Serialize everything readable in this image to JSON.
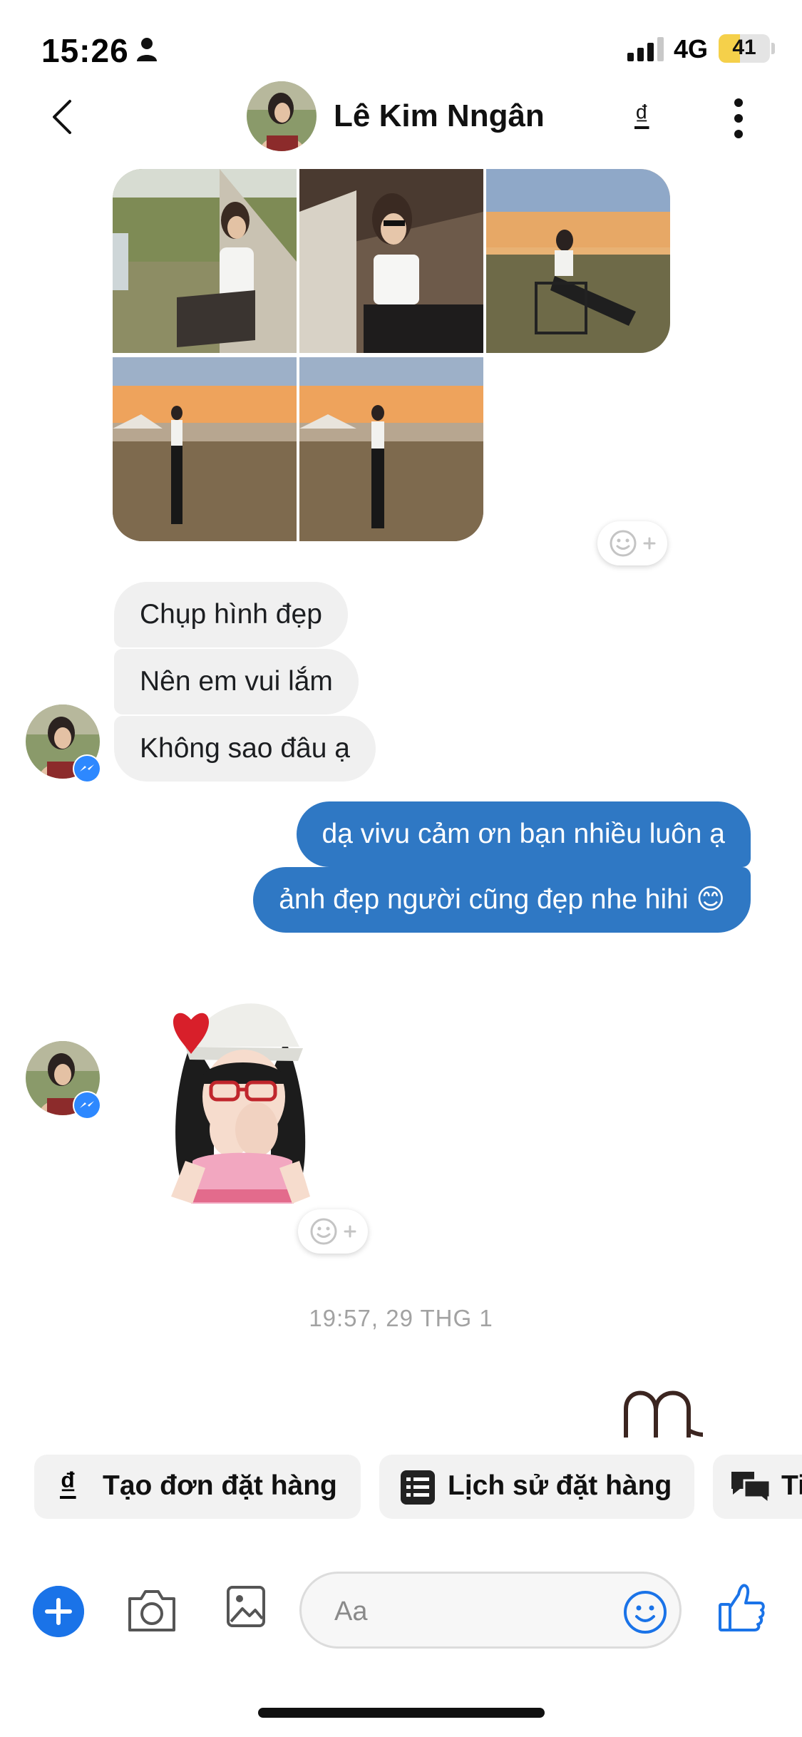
{
  "status_bar": {
    "time": "15:26",
    "network": "4G",
    "battery": "41"
  },
  "header": {
    "contact_name": "Lê Kim Nngân",
    "currency_symbol": "₫"
  },
  "messages": {
    "incoming_texts": [
      "Chụp hình đẹp",
      "Nên em vui lắm",
      "Không sao đâu ạ"
    ],
    "outgoing_texts": [
      "dạ vivu cảm ơn bạn nhiều luôn ạ",
      "ảnh đẹp người cũng đẹp nhe hihi 😊"
    ]
  },
  "timestamp": "19:57, 29 THG 1",
  "quick_actions": {
    "create_order": "Tạo đơn đặt hàng",
    "order_history": "Lịch sử đặt hàng",
    "more": "Ti"
  },
  "composer": {
    "placeholder": "Aa"
  },
  "colors": {
    "outgoing_bubble": "#2f78c4",
    "incoming_bubble": "#f0f0f0",
    "accent": "#1a73e8"
  }
}
